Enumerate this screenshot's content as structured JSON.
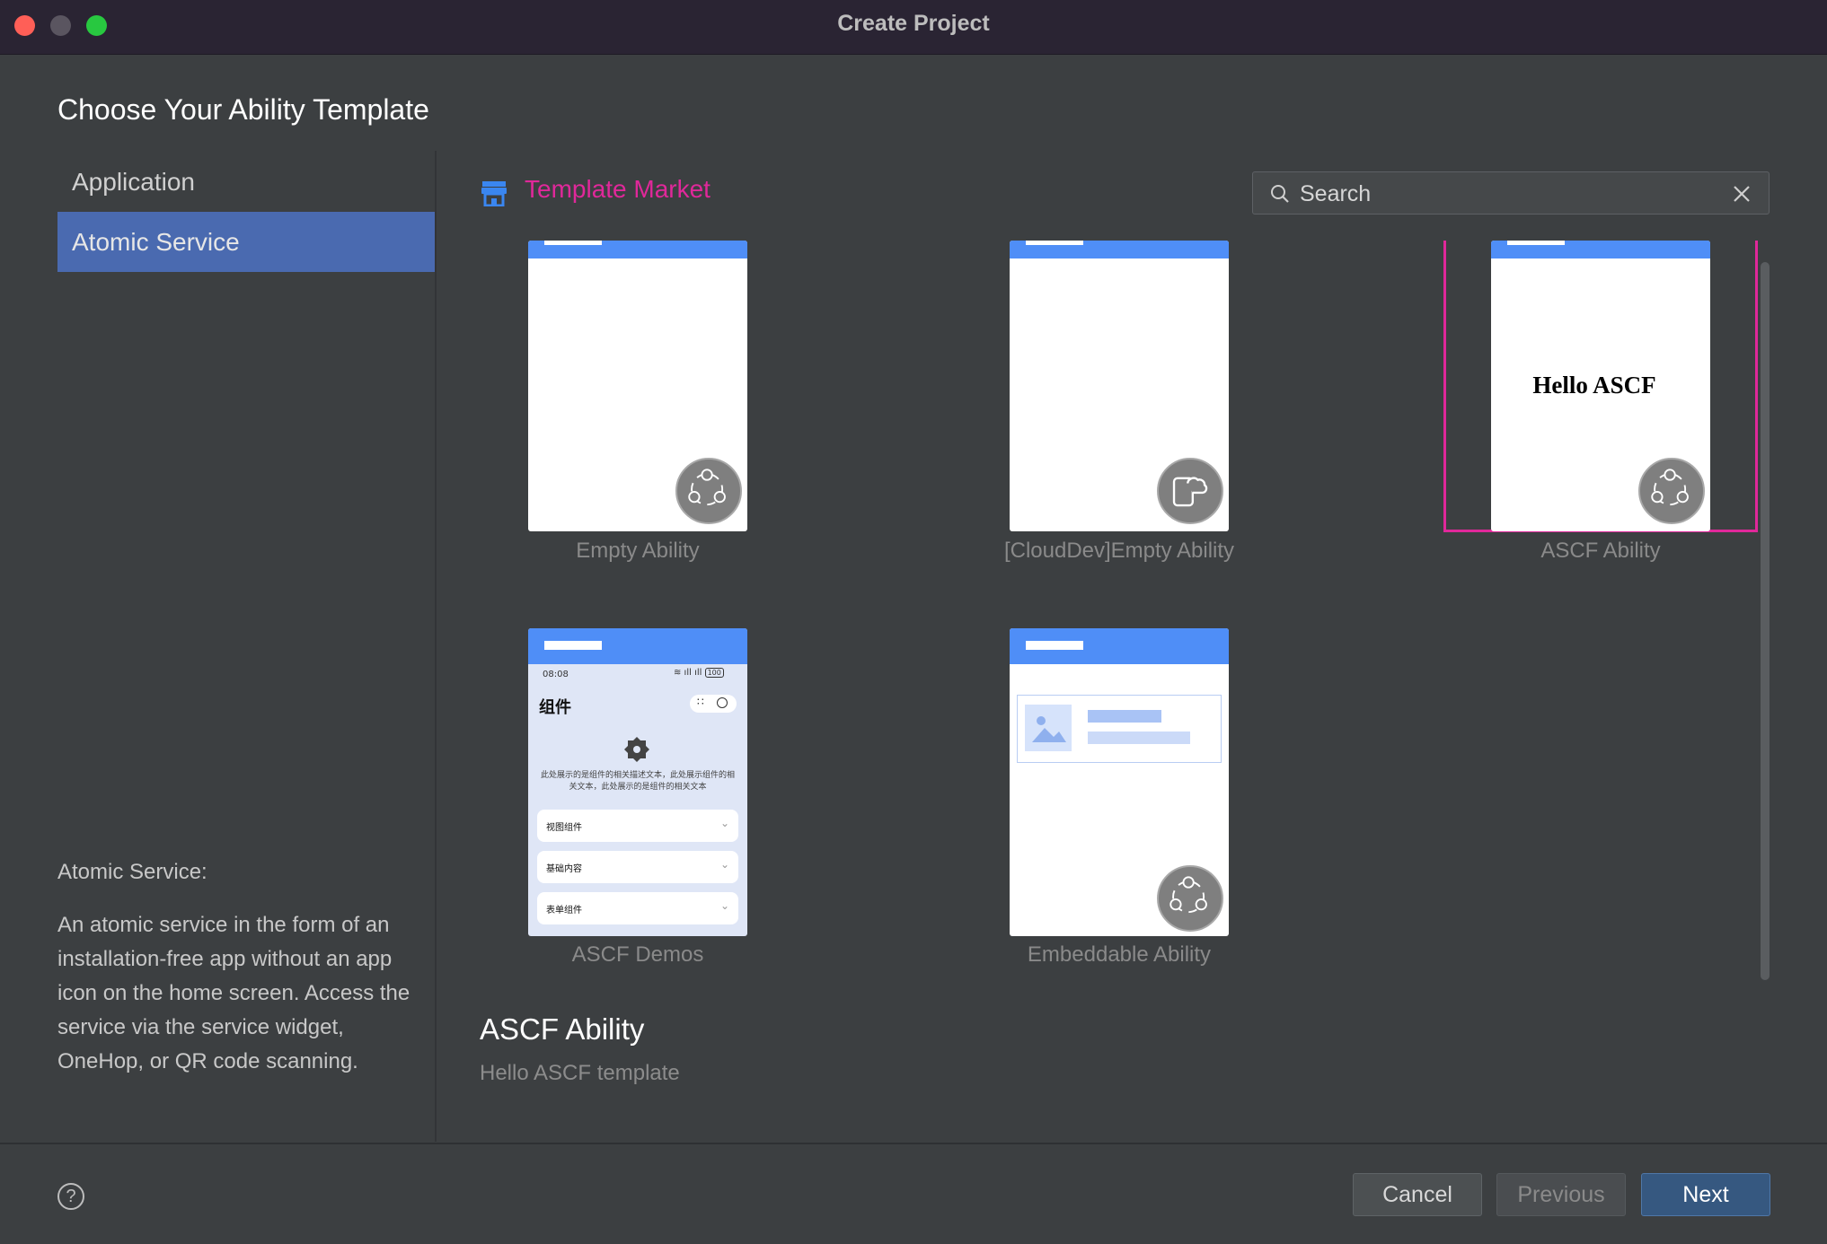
{
  "window": {
    "title": "Create Project"
  },
  "heading": "Choose Your Ability Template",
  "sidebar": {
    "items": [
      {
        "label": "Application",
        "selected": false
      },
      {
        "label": "Atomic Service",
        "selected": true
      }
    ]
  },
  "description": {
    "title": "Atomic Service:",
    "body": "An atomic service in the form of an installation-free app without an app icon on the home screen. Access the service via the service widget, OneHop, or QR code scanning."
  },
  "market": {
    "label": "Template Market",
    "icon": "store-icon",
    "color": "#e0289a"
  },
  "search": {
    "placeholder": "Search",
    "value": ""
  },
  "templates": [
    {
      "name": "Empty Ability",
      "icon": "atomic-service-icon",
      "selected": false
    },
    {
      "name": "[CloudDev]Empty Ability",
      "icon": "cloud-phone-icon",
      "selected": false
    },
    {
      "name": "ASCF Ability",
      "icon": "atomic-service-icon",
      "selected": true,
      "preview_text": "Hello ASCF"
    },
    {
      "name": "ASCF Demos",
      "selected": false,
      "preview": {
        "time": "08:08",
        "battery": "100",
        "title": "组件",
        "desc": "此处展示的是组件的相关描述文本，此处展示组件的相关文本，此处展示的是组件的相关文本",
        "rows": [
          "视图组件",
          "基础内容",
          "表单组件"
        ]
      }
    },
    {
      "name": "Embeddable Ability",
      "icon": "atomic-service-icon",
      "selected": false
    }
  ],
  "detail": {
    "title": "ASCF Ability",
    "subtitle": "Hello ASCF template"
  },
  "buttons": {
    "cancel": "Cancel",
    "previous": "Previous",
    "next": "Next",
    "help": "?"
  },
  "colors": {
    "accent": "#4f8ef7",
    "selection": "#e0289a",
    "primary_button": "#365880"
  }
}
